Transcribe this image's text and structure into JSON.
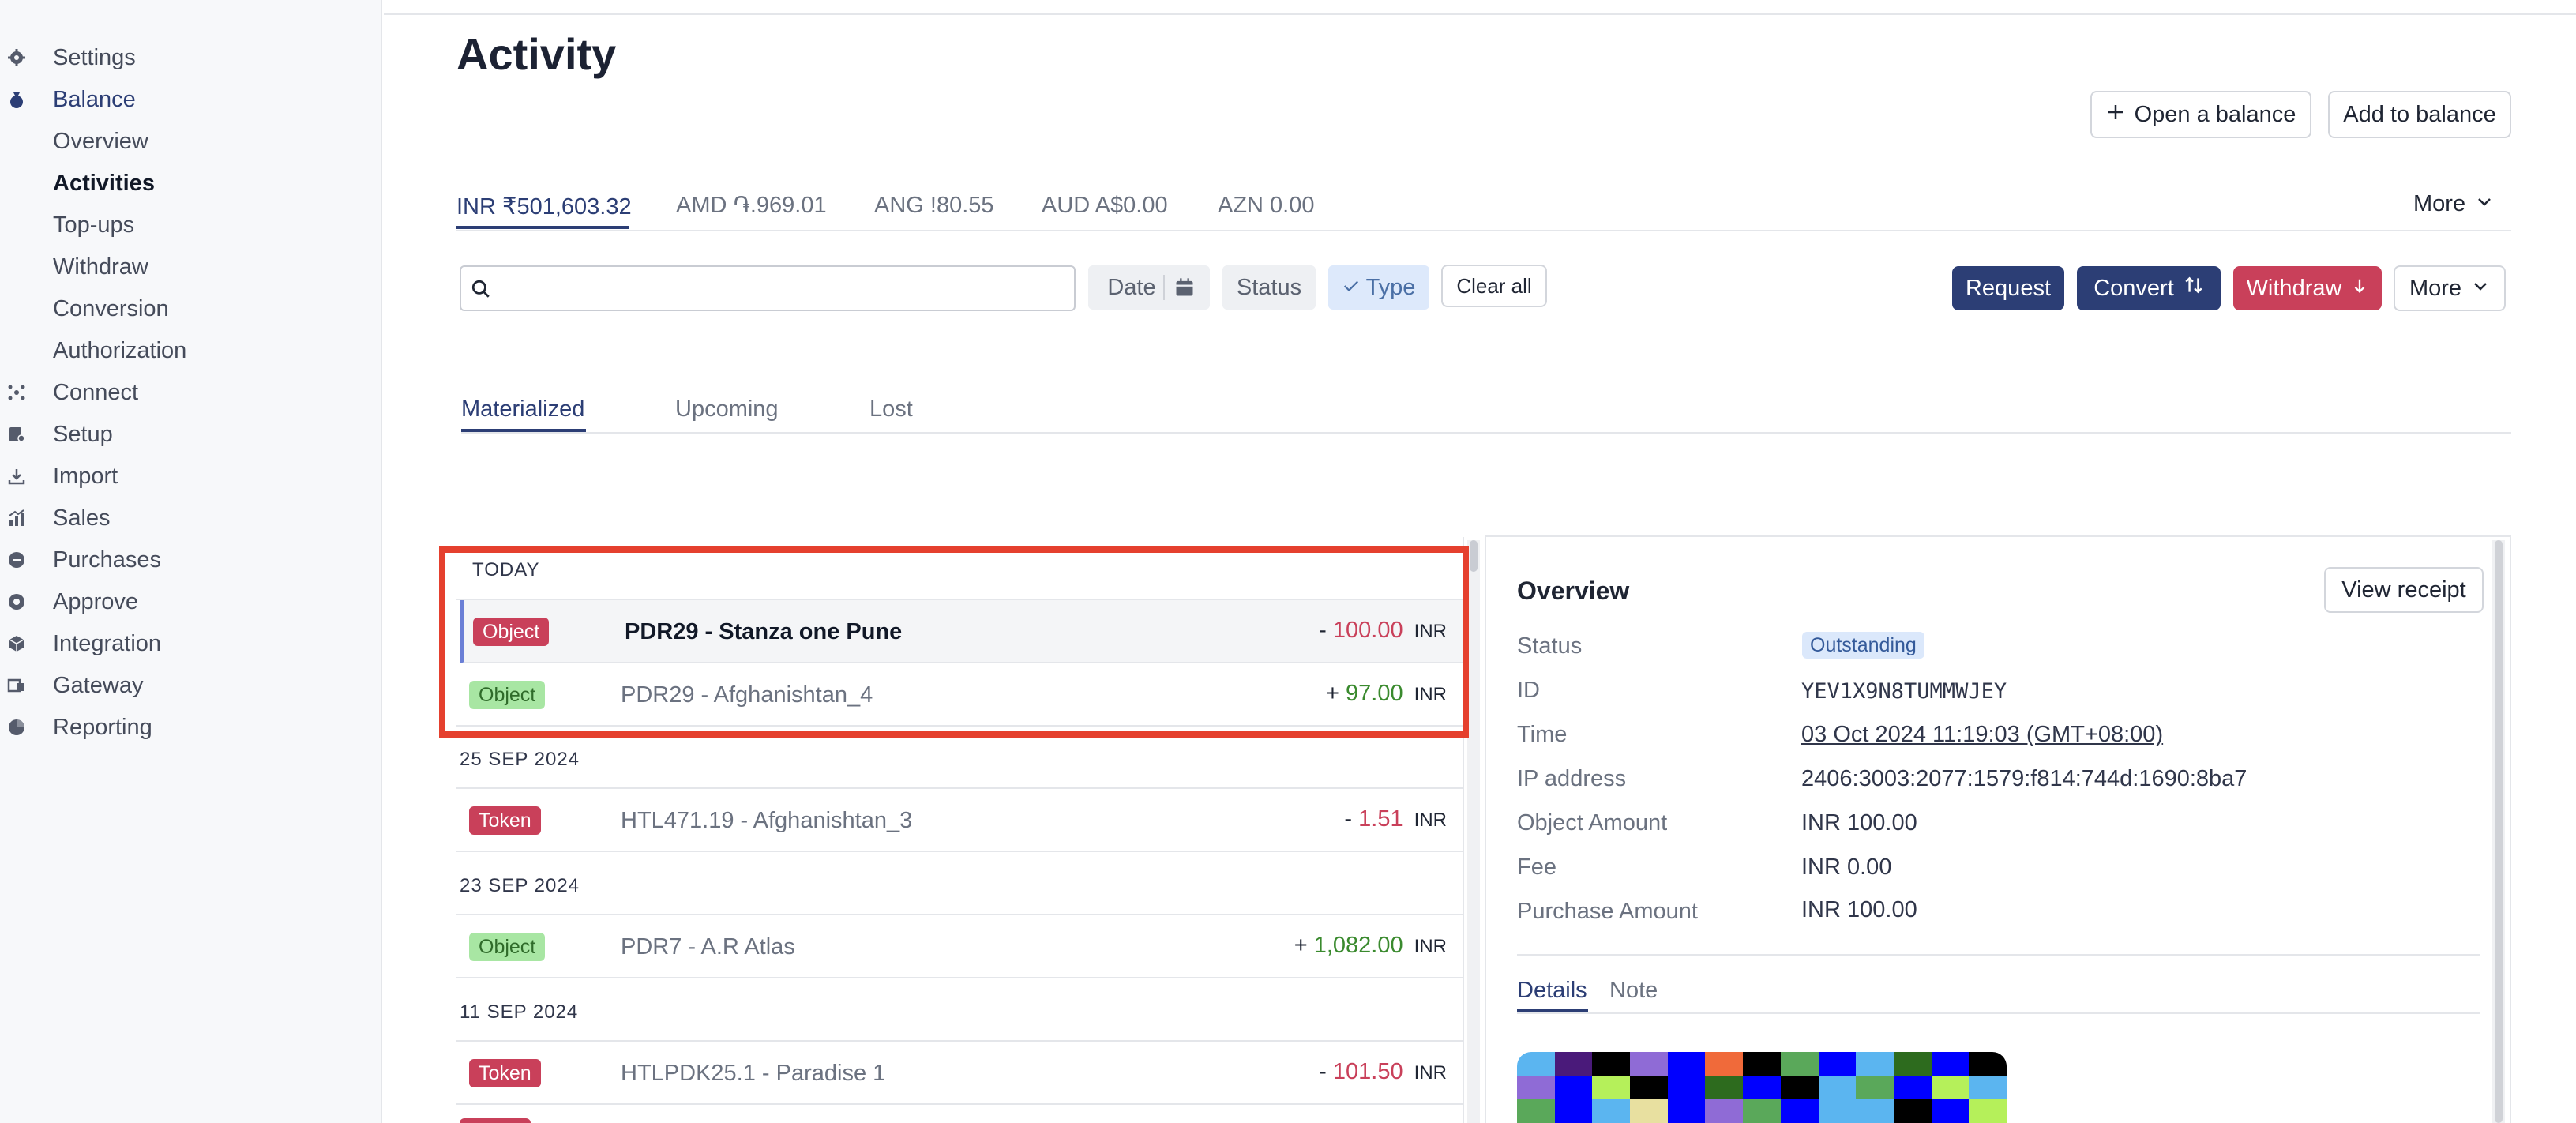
{
  "sidebar": {
    "items": [
      {
        "label": "Settings",
        "icon": "gear-icon"
      },
      {
        "label": "Balance",
        "icon": "money-bag-icon"
      },
      {
        "label": "Overview"
      },
      {
        "label": "Activities"
      },
      {
        "label": "Top-ups"
      },
      {
        "label": "Withdraw"
      },
      {
        "label": "Conversion"
      },
      {
        "label": "Authorization"
      },
      {
        "label": "Connect",
        "icon": "network-icon"
      },
      {
        "label": "Setup",
        "icon": "setup-icon"
      },
      {
        "label": "Import",
        "icon": "import-icon"
      },
      {
        "label": "Sales",
        "icon": "sales-chart-icon"
      },
      {
        "label": "Purchases",
        "icon": "purchases-icon"
      },
      {
        "label": "Approve",
        "icon": "approve-icon"
      },
      {
        "label": "Integration",
        "icon": "integration-box-icon"
      },
      {
        "label": "Gateway",
        "icon": "gateway-icon"
      },
      {
        "label": "Reporting",
        "icon": "reporting-icon"
      }
    ]
  },
  "header": {
    "title": "Activity",
    "open_balance_label": "Open a balance",
    "add_to_balance_label": "Add to balance"
  },
  "currency_tabs": {
    "tabs": [
      {
        "label": "INR ₹501,603.32"
      },
      {
        "label": "AMD ֏.969.01"
      },
      {
        "label": "ANG !80.55"
      },
      {
        "label": "AUD A$0.00"
      },
      {
        "label": "AZN 0.00"
      }
    ],
    "more_label": "More"
  },
  "filters": {
    "search_placeholder": "",
    "date_label": "Date",
    "status_label": "Status",
    "type_label": "Type",
    "clear_all_label": "Clear all"
  },
  "actions": {
    "request_label": "Request",
    "convert_label": "Convert",
    "withdraw_label": "Withdraw",
    "more_label": "More"
  },
  "sub_tabs": [
    "Materialized",
    "Upcoming",
    "Lost"
  ],
  "activity_groups": [
    {
      "header": "TODAY",
      "rows": [
        {
          "badge": "Object",
          "badge_color": "#c9405a",
          "title": "PDR29 - Stanza one Pune",
          "sign": "-",
          "amount": "100.00",
          "currency": "INR"
        },
        {
          "badge": "Object",
          "badge_color": "#a8e6a3",
          "title": "PDR29 - Afghanishtan_4",
          "sign": "+",
          "amount": "97.00",
          "currency": "INR"
        }
      ]
    },
    {
      "header": "25 SEP 2024",
      "rows": [
        {
          "badge": "Token",
          "badge_color": "#c9405a",
          "title": "HTL471.19 - Afghanishtan_3",
          "sign": "-",
          "amount": "1.51",
          "currency": "INR"
        }
      ]
    },
    {
      "header": "23 SEP 2024",
      "rows": [
        {
          "badge": "Object",
          "badge_color": "#a8e6a3",
          "title": "PDR7 - A.R Atlas",
          "sign": "+",
          "amount": "1,082.00",
          "currency": "INR"
        }
      ]
    },
    {
      "header": "11 SEP 2024",
      "rows": [
        {
          "badge": "Token",
          "badge_color": "#c9405a",
          "title": "HTLPDK25.1 - Paradise 1",
          "sign": "-",
          "amount": "101.50",
          "currency": "INR"
        }
      ]
    }
  ],
  "detail": {
    "title": "Overview",
    "view_receipt_label": "View receipt",
    "fields": [
      {
        "label": "Status",
        "value": "Outstanding"
      },
      {
        "label": "ID",
        "value": "YEV1X9N8TUMMWJEY"
      },
      {
        "label": "Time",
        "value": "03 Oct 2024 11:19:03 (GMT+08:00)"
      },
      {
        "label": "IP address",
        "value": "2406:3003:2077:1579:f814:744d:1690:8ba7"
      },
      {
        "label": "Object Amount",
        "value": "INR 100.00"
      },
      {
        "label": "Fee",
        "value": "INR 0.00"
      },
      {
        "label": "Purchase Amount",
        "value": "INR 100.00"
      }
    ],
    "tabs": [
      "Details",
      "Note"
    ]
  },
  "colors": {
    "accent": "#2c3e75",
    "danger": "#c9405a",
    "highlight": "#e5402e",
    "positive": "#3a8a2e"
  }
}
